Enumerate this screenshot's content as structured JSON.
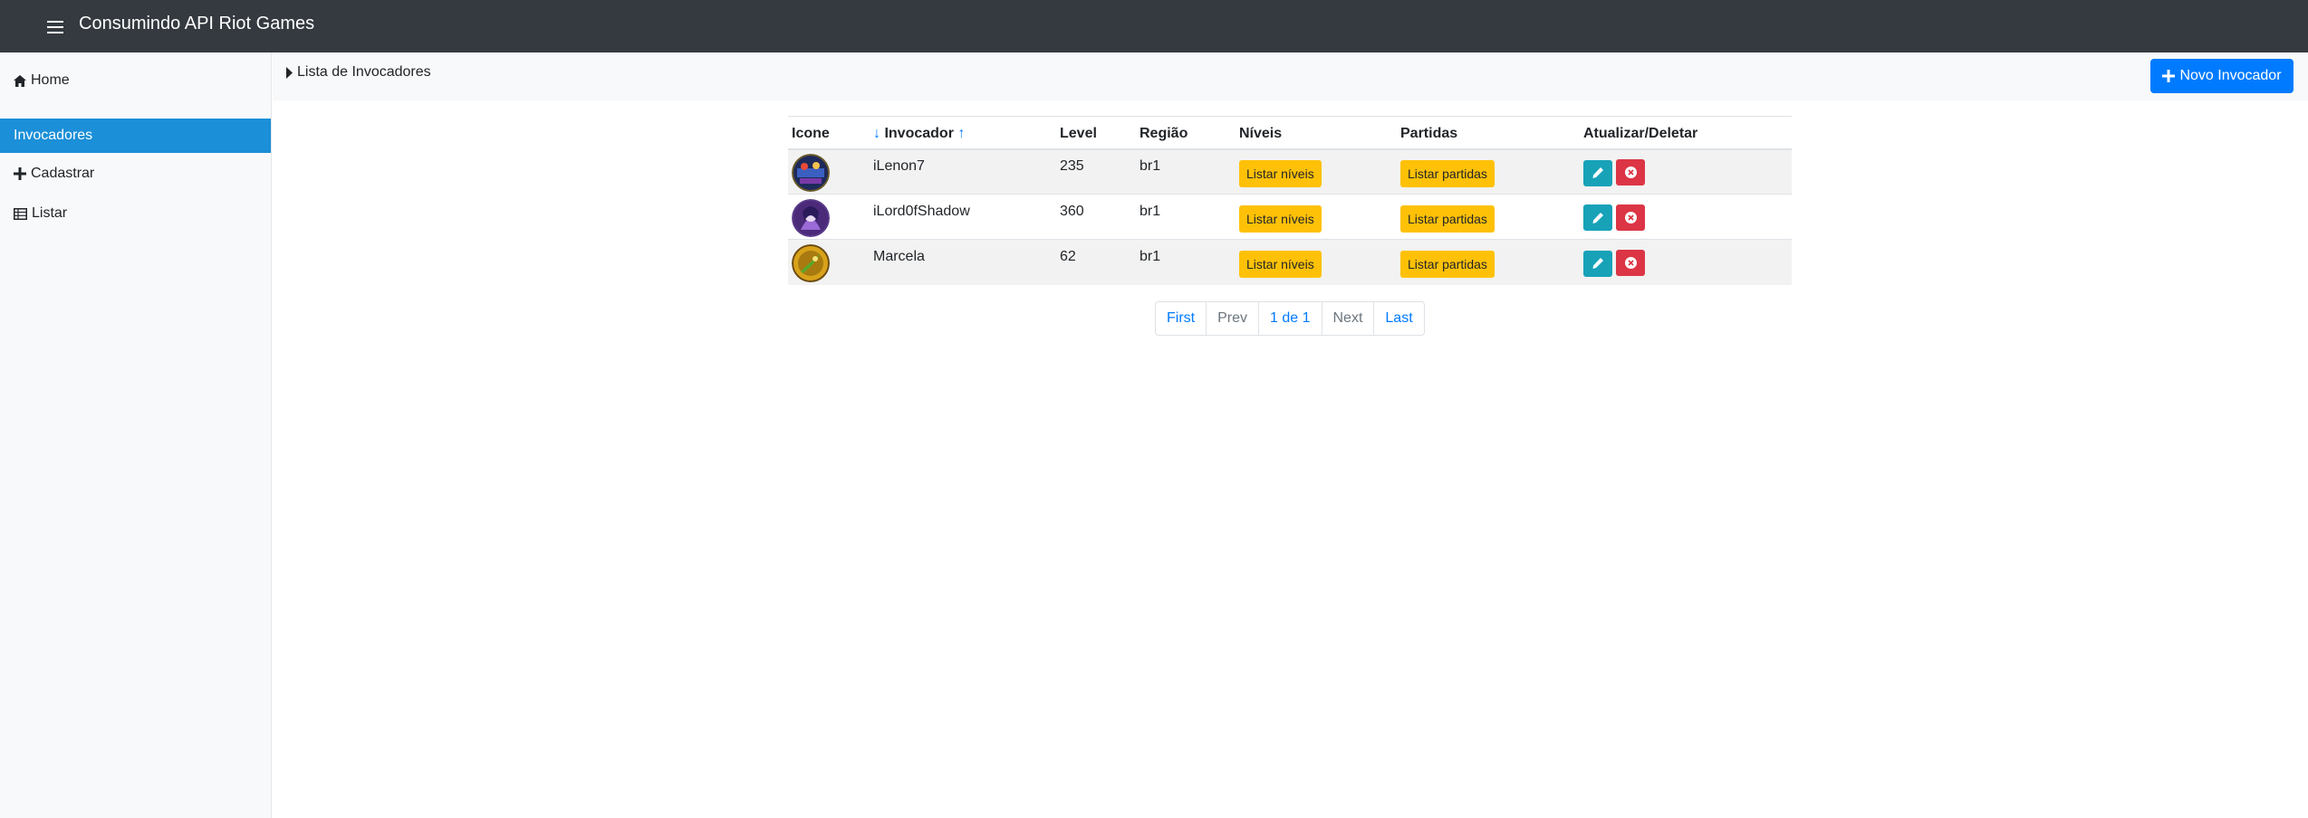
{
  "header": {
    "title": "Consumindo API Riot Games",
    "menu_icon": "hamburger-icon"
  },
  "sidebar": {
    "home": "Home",
    "section": "Invocadores",
    "cadastrar": "Cadastrar",
    "listar": "Listar"
  },
  "breadcrumb": {
    "label": "Lista de Invocadores"
  },
  "actions": {
    "new_label": "Novo Invocador"
  },
  "table": {
    "headers": {
      "icon": "Icone",
      "invocador": "Invocador",
      "level": "Level",
      "regiao": "Região",
      "niveis": "Níveis",
      "partidas": "Partidas",
      "acoes": "Atualizar/Deletar"
    },
    "rows": [
      {
        "name": "iLenon7",
        "level": "235",
        "region": "br1",
        "niveis_btn": "Listar níveis",
        "partidas_btn": "Listar partidas"
      },
      {
        "name": "iLord0fShadow",
        "level": "360",
        "region": "br1",
        "niveis_btn": "Listar níveis",
        "partidas_btn": "Listar partidas"
      },
      {
        "name": "Marcela",
        "level": "62",
        "region": "br1",
        "niveis_btn": "Listar níveis",
        "partidas_btn": "Listar partidas"
      }
    ]
  },
  "pagination": {
    "first": "First",
    "prev": "Prev",
    "current": "1 de 1",
    "next": "Next",
    "last": "Last"
  },
  "colors": {
    "topbar": "#343a40",
    "active": "#1b8fd8",
    "primary": "#007bff",
    "warning": "#ffc107",
    "info": "#17a2b8",
    "danger": "#dc3545"
  }
}
